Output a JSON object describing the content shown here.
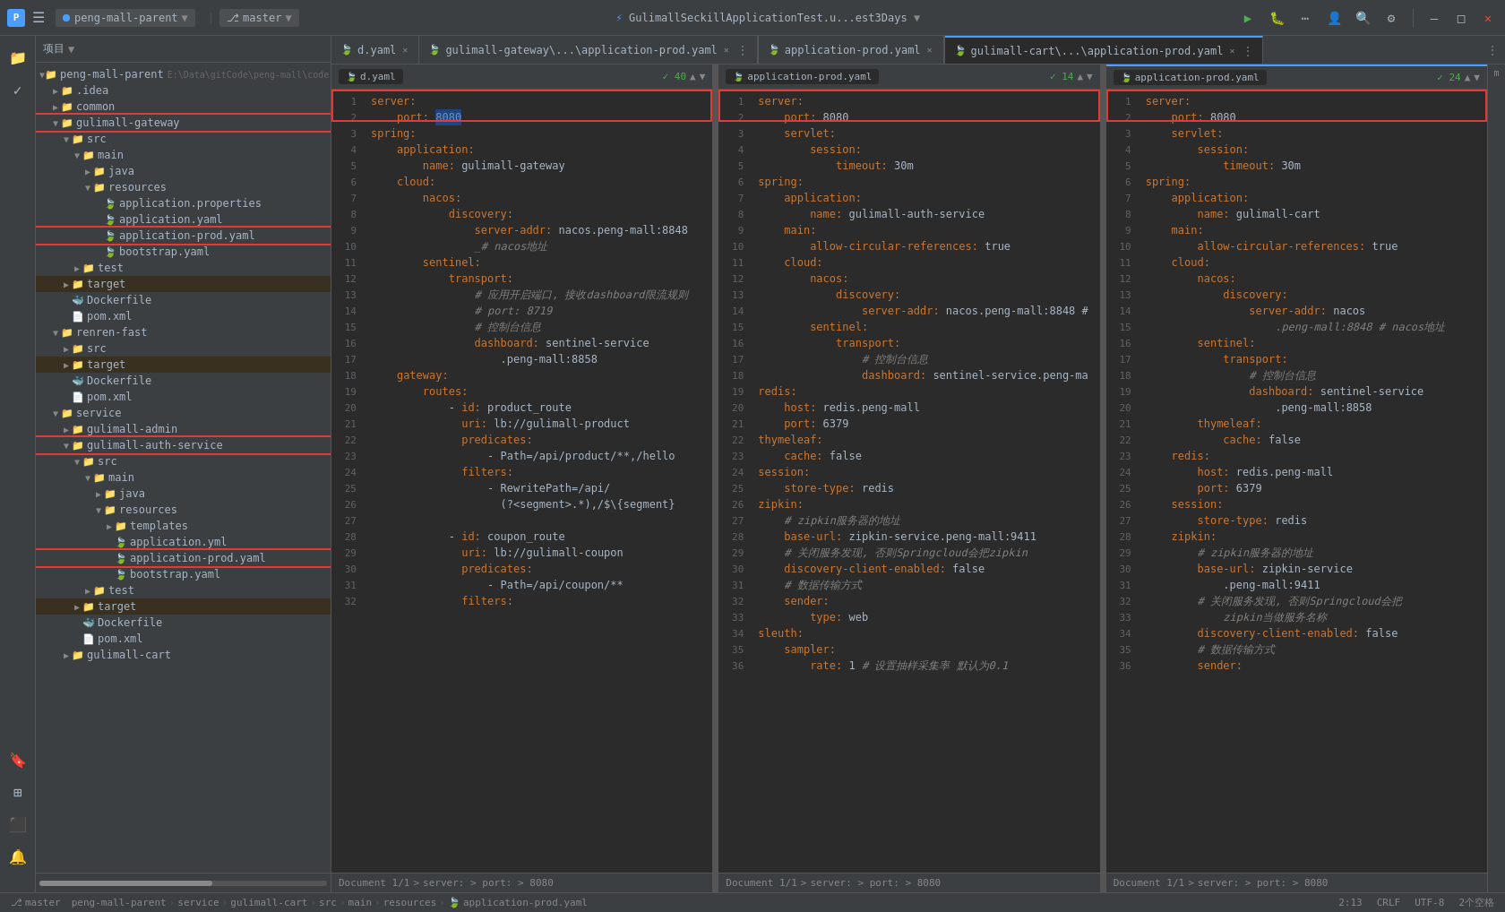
{
  "titlebar": {
    "app_icon": "P",
    "menu_items": [
      "项目",
      "▼"
    ],
    "project_tab": "peng-mall-parent",
    "branch_tab": "master",
    "center_title": "GulimallSeckillApplicationTest.u...est3Days",
    "run_icon": "▶",
    "bug_icon": "🐞",
    "more_icon": "⋯",
    "user_icon": "👤",
    "search_icon": "🔍",
    "settings_icon": "⚙",
    "minimize": "—",
    "maximize": "□",
    "close": "✕"
  },
  "filetree": {
    "header": "项目",
    "items": [
      {
        "id": "peng-mall-parent",
        "label": "peng-mall-parent",
        "path": "E:\\Data\\gitCode\\peng-mall\\code",
        "level": 0,
        "type": "root",
        "expanded": true
      },
      {
        "id": "idea",
        "label": ".idea",
        "level": 1,
        "type": "folder",
        "expanded": false
      },
      {
        "id": "common",
        "label": "common",
        "level": 1,
        "type": "folder",
        "expanded": false
      },
      {
        "id": "gulimall-gateway",
        "label": "gulimall-gateway",
        "level": 1,
        "type": "folder",
        "expanded": true,
        "highlighted": true
      },
      {
        "id": "src",
        "label": "src",
        "level": 2,
        "type": "folder",
        "expanded": true
      },
      {
        "id": "main",
        "label": "main",
        "level": 3,
        "type": "folder",
        "expanded": true
      },
      {
        "id": "java",
        "label": "java",
        "level": 4,
        "type": "folder",
        "expanded": false
      },
      {
        "id": "resources",
        "label": "resources",
        "level": 4,
        "type": "folder",
        "expanded": true
      },
      {
        "id": "app-props",
        "label": "application.properties",
        "level": 5,
        "type": "props"
      },
      {
        "id": "app-yaml",
        "label": "application.yaml",
        "level": 5,
        "type": "yaml"
      },
      {
        "id": "app-prod-yaml-gw",
        "label": "application-prod.yaml",
        "level": 5,
        "type": "yaml",
        "highlighted": true
      },
      {
        "id": "bootstrap-yaml-gw",
        "label": "bootstrap.yaml",
        "level": 5,
        "type": "yaml"
      },
      {
        "id": "test-gw",
        "label": "test",
        "level": 3,
        "type": "folder",
        "expanded": false
      },
      {
        "id": "target-gw",
        "label": "target",
        "level": 2,
        "type": "folder",
        "expanded": false,
        "highlighted_bg": true
      },
      {
        "id": "dockerfile-gw",
        "label": "Dockerfile",
        "level": 2,
        "type": "docker"
      },
      {
        "id": "pom-gw",
        "label": "pom.xml",
        "level": 2,
        "type": "xml"
      },
      {
        "id": "renren-fast",
        "label": "renren-fast",
        "level": 1,
        "type": "folder",
        "expanded": true
      },
      {
        "id": "src-rr",
        "label": "src",
        "level": 2,
        "type": "folder",
        "expanded": false
      },
      {
        "id": "target-rr",
        "label": "target",
        "level": 2,
        "type": "folder",
        "expanded": false,
        "highlighted_bg": true
      },
      {
        "id": "dockerfile-rr",
        "label": "Dockerfile",
        "level": 2,
        "type": "docker"
      },
      {
        "id": "pom-rr",
        "label": "pom.xml",
        "level": 2,
        "type": "xml"
      },
      {
        "id": "service",
        "label": "service",
        "level": 1,
        "type": "folder",
        "expanded": true
      },
      {
        "id": "gulimall-admin",
        "label": "gulimall-admin",
        "level": 2,
        "type": "folder",
        "expanded": false
      },
      {
        "id": "gulimall-auth-service",
        "label": "gulimall-auth-service",
        "level": 2,
        "type": "folder",
        "expanded": true,
        "highlighted": true
      },
      {
        "id": "src-auth",
        "label": "src",
        "level": 3,
        "type": "folder",
        "expanded": true
      },
      {
        "id": "main-auth",
        "label": "main",
        "level": 4,
        "type": "folder",
        "expanded": true
      },
      {
        "id": "java-auth",
        "label": "java",
        "level": 5,
        "type": "folder",
        "expanded": false
      },
      {
        "id": "resources-auth",
        "label": "resources",
        "level": 5,
        "type": "folder",
        "expanded": true
      },
      {
        "id": "templates",
        "label": "templates",
        "level": 6,
        "type": "folder",
        "expanded": false
      },
      {
        "id": "app-yaml-auth",
        "label": "application.yml",
        "level": 6,
        "type": "yaml"
      },
      {
        "id": "app-prod-yaml-auth",
        "label": "application-prod.yaml",
        "level": 6,
        "type": "yaml",
        "highlighted": true
      },
      {
        "id": "bootstrap-yaml-auth",
        "label": "bootstrap.yaml",
        "level": 6,
        "type": "yaml"
      },
      {
        "id": "test-auth",
        "label": "test",
        "level": 4,
        "type": "folder",
        "expanded": false
      },
      {
        "id": "target-auth",
        "label": "target",
        "level": 3,
        "type": "folder",
        "expanded": false,
        "highlighted_bg": true
      },
      {
        "id": "dockerfile-auth",
        "label": "Dockerfile",
        "level": 3,
        "type": "docker"
      },
      {
        "id": "pom-auth",
        "label": "pom.xml",
        "level": 3,
        "type": "xml"
      },
      {
        "id": "gulimall-cart",
        "label": "gulimall-cart",
        "level": 2,
        "type": "folder",
        "expanded": false
      }
    ]
  },
  "tabs": [
    {
      "id": "tab1",
      "label": "d.yaml",
      "active": false,
      "closable": true
    },
    {
      "id": "tab2",
      "label": "gulimall-gateway\\...\\application-prod.yaml",
      "active": false,
      "closable": true,
      "more": true
    },
    {
      "id": "tab3",
      "label": "application-prod.yaml",
      "active": false,
      "closable": true
    },
    {
      "id": "tab4",
      "label": "gulimall-cart\\...\\application-prod.yaml",
      "active": true,
      "closable": true,
      "more": true
    }
  ],
  "panels": [
    {
      "id": "panel1",
      "header": {
        "filename": "d.yaml",
        "checks": "40",
        "arrow_up": "▲",
        "arrow_down": "▼"
      },
      "lines": [
        {
          "num": 1,
          "text": "server:",
          "type": "key"
        },
        {
          "num": 2,
          "text": "    port: 8080",
          "type": "val"
        },
        {
          "num": 3,
          "text": "spring:",
          "type": "key"
        },
        {
          "num": 4,
          "text": "    application:",
          "type": "key"
        },
        {
          "num": 5,
          "text": "        name: gulimall-gateway",
          "type": "val"
        },
        {
          "num": 6,
          "text": "    cloud:",
          "type": "key"
        },
        {
          "num": 7,
          "text": "        nacos:",
          "type": "key"
        },
        {
          "num": 8,
          "text": "            discovery:",
          "type": "key"
        },
        {
          "num": 9,
          "text": "                server-addr: nacos.peng-mall:8848",
          "type": "val"
        },
        {
          "num": 10,
          "text": "                _# nacos地址",
          "type": "comment"
        },
        {
          "num": 11,
          "text": "        sentinel:",
          "type": "key"
        },
        {
          "num": 12,
          "text": "            transport:",
          "type": "key"
        },
        {
          "num": 13,
          "text": "                # 应用开启端口, 接收dashboard限流规则",
          "type": "comment"
        },
        {
          "num": 14,
          "text": "                # port: 8719",
          "type": "comment"
        },
        {
          "num": 15,
          "text": "                # 控制台信息",
          "type": "comment"
        },
        {
          "num": 16,
          "text": "                dashboard: sentinel-service",
          "type": "val"
        },
        {
          "num": 17,
          "text": "                    .peng-mall:8858",
          "type": "val"
        },
        {
          "num": 18,
          "text": "    gateway:",
          "type": "key"
        },
        {
          "num": 19,
          "text": "        routes:",
          "type": "key"
        },
        {
          "num": 20,
          "text": "            - id: product_route",
          "type": "val"
        },
        {
          "num": 21,
          "text": "              uri: lb://gulimall-product",
          "type": "val"
        },
        {
          "num": 22,
          "text": "              predicates:",
          "type": "key"
        },
        {
          "num": 23,
          "text": "                  - Path=/api/product/**,/hello",
          "type": "val"
        },
        {
          "num": 24,
          "text": "              filters:",
          "type": "key"
        },
        {
          "num": 25,
          "text": "                  - RewritePath=/api/",
          "type": "val"
        },
        {
          "num": 26,
          "text": "                    (?<segment>.*),/$\\{segment}",
          "type": "val"
        },
        {
          "num": 27,
          "text": "",
          "type": "val"
        },
        {
          "num": 28,
          "text": "            - id: coupon_route",
          "type": "val"
        },
        {
          "num": 29,
          "text": "              uri: lb://gulimall-coupon",
          "type": "val"
        },
        {
          "num": 30,
          "text": "              predicates:",
          "type": "key"
        },
        {
          "num": 31,
          "text": "                  - Path=/api/coupon/**",
          "type": "val"
        },
        {
          "num": 32,
          "text": "              filters:",
          "type": "key"
        }
      ],
      "footer": {
        "doc": "Document 1/1",
        "path": "server: > port: > 8080"
      }
    },
    {
      "id": "panel2",
      "header": {
        "filename": "application-prod.yaml",
        "checks": "14",
        "arrow_up": "▲",
        "arrow_down": "▼"
      },
      "lines": [
        {
          "num": 1,
          "text": "server:",
          "type": "key"
        },
        {
          "num": 2,
          "text": "    port: 8080",
          "type": "val"
        },
        {
          "num": 3,
          "text": "    servlet:",
          "type": "key"
        },
        {
          "num": 4,
          "text": "        session:",
          "type": "key"
        },
        {
          "num": 5,
          "text": "            timeout: 30m",
          "type": "val"
        },
        {
          "num": 6,
          "text": "spring:",
          "type": "key"
        },
        {
          "num": 7,
          "text": "    application:",
          "type": "key"
        },
        {
          "num": 8,
          "text": "        name: gulimall-auth-service",
          "type": "val"
        },
        {
          "num": 9,
          "text": "    main:",
          "type": "key"
        },
        {
          "num": 10,
          "text": "        allow-circular-references: true",
          "type": "val"
        },
        {
          "num": 11,
          "text": "    cloud:",
          "type": "key"
        },
        {
          "num": 12,
          "text": "        nacos:",
          "type": "key"
        },
        {
          "num": 13,
          "text": "            discovery:",
          "type": "key"
        },
        {
          "num": 14,
          "text": "                server-addr: nacos.peng-mall:8848 #",
          "type": "val"
        },
        {
          "num": 15,
          "text": "        sentinel:",
          "type": "key"
        },
        {
          "num": 16,
          "text": "            transport:",
          "type": "key"
        },
        {
          "num": 17,
          "text": "                # 控制台信息",
          "type": "comment"
        },
        {
          "num": 18,
          "text": "                dashboard: sentinel-service.peng-ma",
          "type": "val"
        },
        {
          "num": 19,
          "text": "redis:",
          "type": "key"
        },
        {
          "num": 20,
          "text": "    host: redis.peng-mall",
          "type": "val"
        },
        {
          "num": 21,
          "text": "    port: 6379",
          "type": "val"
        },
        {
          "num": 22,
          "text": "thymeleaf:",
          "type": "key"
        },
        {
          "num": 23,
          "text": "    cache: false",
          "type": "val"
        },
        {
          "num": 24,
          "text": "session:",
          "type": "key"
        },
        {
          "num": 25,
          "text": "    store-type: redis",
          "type": "val"
        },
        {
          "num": 26,
          "text": "zipkin:",
          "type": "key"
        },
        {
          "num": 27,
          "text": "    # zipkin服务器的地址",
          "type": "comment"
        },
        {
          "num": 28,
          "text": "    base-url: zipkin-service.peng-mall:9411",
          "type": "val"
        },
        {
          "num": 29,
          "text": "    # 关闭服务发现, 否则Springcloud会把zipkin",
          "type": "comment"
        },
        {
          "num": 30,
          "text": "    discovery-client-enabled: false",
          "type": "val"
        },
        {
          "num": 31,
          "text": "    # 数据传输方式",
          "type": "comment"
        },
        {
          "num": 32,
          "text": "    sender:",
          "type": "key"
        },
        {
          "num": 33,
          "text": "        type: web",
          "type": "val"
        },
        {
          "num": 34,
          "text": "sleuth:",
          "type": "key"
        },
        {
          "num": 35,
          "text": "    sampler:",
          "type": "key"
        },
        {
          "num": 36,
          "text": "        rate: 1 # 设置抽样采集率 默认为0.1",
          "type": "val"
        }
      ],
      "footer": {
        "doc": "Document 1/1",
        "path": "server: > port: > 8080"
      }
    },
    {
      "id": "panel3",
      "header": {
        "filename": "application-prod.yaml",
        "checks": "24",
        "arrow_up": "▲",
        "arrow_down": "▼"
      },
      "lines": [
        {
          "num": 1,
          "text": "server:",
          "type": "key"
        },
        {
          "num": 2,
          "text": "    port: 8080",
          "type": "val",
          "cursor": true
        },
        {
          "num": 3,
          "text": "    servlet:",
          "type": "key"
        },
        {
          "num": 4,
          "text": "        session:",
          "type": "key"
        },
        {
          "num": 5,
          "text": "            timeout: 30m",
          "type": "val"
        },
        {
          "num": 6,
          "text": "spring:",
          "type": "key"
        },
        {
          "num": 7,
          "text": "    application:",
          "type": "key"
        },
        {
          "num": 8,
          "text": "        name: gulimall-cart",
          "type": "val"
        },
        {
          "num": 9,
          "text": "    main:",
          "type": "key"
        },
        {
          "num": 10,
          "text": "        allow-circular-references: true",
          "type": "val"
        },
        {
          "num": 11,
          "text": "    cloud:",
          "type": "key"
        },
        {
          "num": 12,
          "text": "        nacos:",
          "type": "key"
        },
        {
          "num": 13,
          "text": "            discovery:",
          "type": "key"
        },
        {
          "num": 14,
          "text": "                server-addr: nacos",
          "type": "val"
        },
        {
          "num": 15,
          "text": "                    .peng-mall:8848 # nacos地址",
          "type": "comment"
        },
        {
          "num": 16,
          "text": "        sentinel:",
          "type": "key"
        },
        {
          "num": 17,
          "text": "            transport:",
          "type": "key"
        },
        {
          "num": 18,
          "text": "                # 控制台信息",
          "type": "comment"
        },
        {
          "num": 19,
          "text": "                dashboard: sentinel-service",
          "type": "val"
        },
        {
          "num": 20,
          "text": "                    .peng-mall:8858",
          "type": "val"
        },
        {
          "num": 21,
          "text": "        thymeleaf:",
          "type": "key"
        },
        {
          "num": 22,
          "text": "            cache: false",
          "type": "val"
        },
        {
          "num": 23,
          "text": "    redis:",
          "type": "key"
        },
        {
          "num": 24,
          "text": "        host: redis.peng-mall",
          "type": "val"
        },
        {
          "num": 25,
          "text": "        port: 6379",
          "type": "val"
        },
        {
          "num": 26,
          "text": "    session:",
          "type": "key"
        },
        {
          "num": 27,
          "text": "        store-type: redis",
          "type": "val"
        },
        {
          "num": 28,
          "text": "    zipkin:",
          "type": "key"
        },
        {
          "num": 29,
          "text": "        # zipkin服务器的地址",
          "type": "comment"
        },
        {
          "num": 30,
          "text": "        base-url: zipkin-service",
          "type": "val"
        },
        {
          "num": 31,
          "text": "            .peng-mall:9411",
          "type": "val"
        },
        {
          "num": 32,
          "text": "        # 关闭服务发现, 否则Springcloud会把",
          "type": "comment"
        },
        {
          "num": 33,
          "text": "            zipkin当做服务名称",
          "type": "comment"
        },
        {
          "num": 34,
          "text": "        discovery-client-enabled: false",
          "type": "val"
        },
        {
          "num": 35,
          "text": "        # 数据传输方式",
          "type": "comment"
        },
        {
          "num": 36,
          "text": "        sender:",
          "type": "key"
        }
      ],
      "footer": {
        "doc": "Document 1/1",
        "path": "server: > port: > 8080"
      }
    }
  ],
  "statusbar": {
    "breadcrumb": [
      "peng-mall-parent",
      "service",
      "gulimall-cart",
      "src",
      "main",
      "resources",
      "application-prod.yaml"
    ],
    "position": "2:13",
    "line_ending": "CRLF",
    "encoding": "UTF-8",
    "indent": "2个空格"
  }
}
